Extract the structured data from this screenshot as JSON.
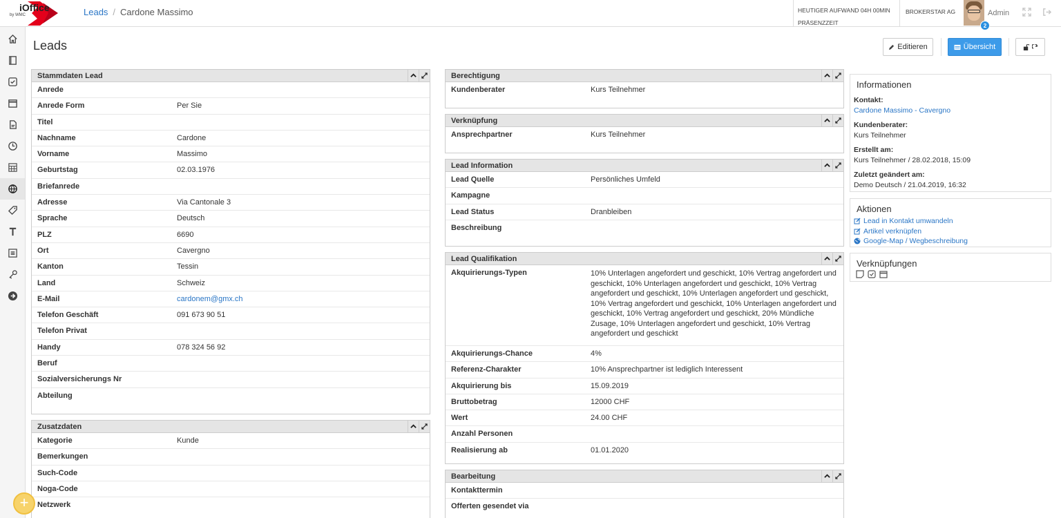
{
  "header": {
    "logo_text": "iOffice",
    "logo_sub": "by WMC",
    "breadcrumb": {
      "parent": "Leads",
      "current": "Cardone Massimo"
    },
    "work_today": "HEUTIGER AUFWAND 04H 00MIN",
    "presence": "PRÄSENZZEIT",
    "company": "BROKERSTAR AG",
    "user": "Admin",
    "notification_count": "2"
  },
  "sidebar": {
    "items": [
      "home",
      "contacts",
      "tasks",
      "calendar",
      "documents",
      "time",
      "reports",
      "leads",
      "tags",
      "text",
      "forms",
      "tools",
      "more"
    ]
  },
  "page": {
    "title": "Leads",
    "buttons": {
      "edit": "Editieren",
      "overview": "Übersicht"
    }
  },
  "stammdaten": {
    "title": "Stammdaten Lead",
    "rows": [
      {
        "label": "Anrede",
        "value": ""
      },
      {
        "label": "Anrede Form",
        "value": "Per Sie"
      },
      {
        "label": "Titel",
        "value": ""
      },
      {
        "label": "Nachname",
        "value": "Cardone"
      },
      {
        "label": "Vorname",
        "value": "Massimo"
      },
      {
        "label": "Geburtstag",
        "value": "02.03.1976"
      },
      {
        "label": "Briefanrede",
        "value": ""
      },
      {
        "label": "Adresse",
        "value": "Via Cantonale 3"
      },
      {
        "label": "Sprache",
        "value": "Deutsch"
      },
      {
        "label": "PLZ",
        "value": "6690"
      },
      {
        "label": "Ort",
        "value": "Cavergno"
      },
      {
        "label": "Kanton",
        "value": "Tessin"
      },
      {
        "label": "Land",
        "value": "Schweiz"
      },
      {
        "label": "E-Mail",
        "value": "cardonem@gmx.ch"
      },
      {
        "label": "Telefon Geschäft",
        "value": "091 673 90 51"
      },
      {
        "label": "Telefon Privat",
        "value": ""
      },
      {
        "label": "Handy",
        "value": "078 324 56 92"
      },
      {
        "label": "Beruf",
        "value": ""
      },
      {
        "label": "Sozialversicherungs Nr",
        "value": ""
      },
      {
        "label": "Abteilung",
        "value": ""
      }
    ]
  },
  "zusatzdaten": {
    "title": "Zusatzdaten",
    "rows": [
      {
        "label": "Kategorie",
        "value": "Kunde"
      },
      {
        "label": "Bemerkungen",
        "value": ""
      },
      {
        "label": "Such-Code",
        "value": ""
      },
      {
        "label": "Noga-Code",
        "value": ""
      },
      {
        "label": "Netzwerk",
        "value": ""
      }
    ]
  },
  "berechtigung": {
    "title": "Berechtigung",
    "rows": [
      {
        "label": "Kundenberater",
        "value": "Kurs Teilnehmer"
      }
    ]
  },
  "verknuepfung": {
    "title": "Verknüpfung",
    "rows": [
      {
        "label": "Ansprechpartner",
        "value": "Kurs Teilnehmer"
      }
    ]
  },
  "lead_information": {
    "title": "Lead Information",
    "rows": [
      {
        "label": "Lead Quelle",
        "value": "Persönliches Umfeld"
      },
      {
        "label": "Kampagne",
        "value": ""
      },
      {
        "label": "Lead Status",
        "value": "Dranbleiben"
      },
      {
        "label": "Beschreibung",
        "value": ""
      }
    ]
  },
  "lead_qualifikation": {
    "title": "Lead Qualifikation",
    "rows": [
      {
        "label": "Akquirierungs-Typen",
        "value": "10% Unterlagen angefordert und geschickt, 10% Vertrag angefordert und geschickt, 10% Unterlagen angefordert und geschickt, 10% Vertrag angefordert und geschickt, 10% Unterlagen angefordert und geschickt, 10% Vertrag angefordert und geschickt, 10% Unterlagen angefordert und geschickt, 10% Vertrag angefordert und geschickt, 20% Mündliche Zusage, 10% Unterlagen angefordert und geschickt, 10% Vertrag angefordert und geschickt"
      },
      {
        "label": "Akquirierungs-Chance",
        "value": "4%"
      },
      {
        "label": "Referenz-Charakter",
        "value": "10% Ansprechpartner ist lediglich Interessent"
      },
      {
        "label": "Akquirierung bis",
        "value": "15.09.2019"
      },
      {
        "label": "Bruttobetrag",
        "value": "12000 CHF"
      },
      {
        "label": "Wert",
        "value": "24.00 CHF"
      },
      {
        "label": "Anzahl Personen",
        "value": ""
      },
      {
        "label": "Realisierung ab",
        "value": "01.01.2020"
      }
    ]
  },
  "bearbeitung": {
    "title": "Bearbeitung",
    "rows": [
      {
        "label": "Kontakttermin",
        "value": ""
      },
      {
        "label": "Offerten gesendet via",
        "value": ""
      }
    ]
  },
  "informationen": {
    "title": "Informationen",
    "kontakt_label": "Kontakt:",
    "kontakt_value": "Cardone Massimo - Cavergno",
    "berater_label": "Kundenberater:",
    "berater_value": "Kurs Teilnehmer",
    "erstellt_label": "Erstellt am:",
    "erstellt_value": "Kurs Teilnehmer / 28.02.2018, 15:09",
    "geaendert_label": "Zuletzt geändert am:",
    "geaendert_value": "Demo Deutsch / 21.04.2019, 16:32"
  },
  "aktionen": {
    "title": "Aktionen",
    "items": [
      "Lead in Kontakt umwandeln",
      "Artikel verknüpfen",
      "Google-Map / Wegbeschreibung"
    ]
  },
  "verknuepfungen": {
    "title": "Verknüpfungen"
  },
  "colors": {
    "accent": "#3d9be9",
    "link": "#2a76c6",
    "logo_red": "#e3001b",
    "panel_header": "#e5e5e5"
  }
}
